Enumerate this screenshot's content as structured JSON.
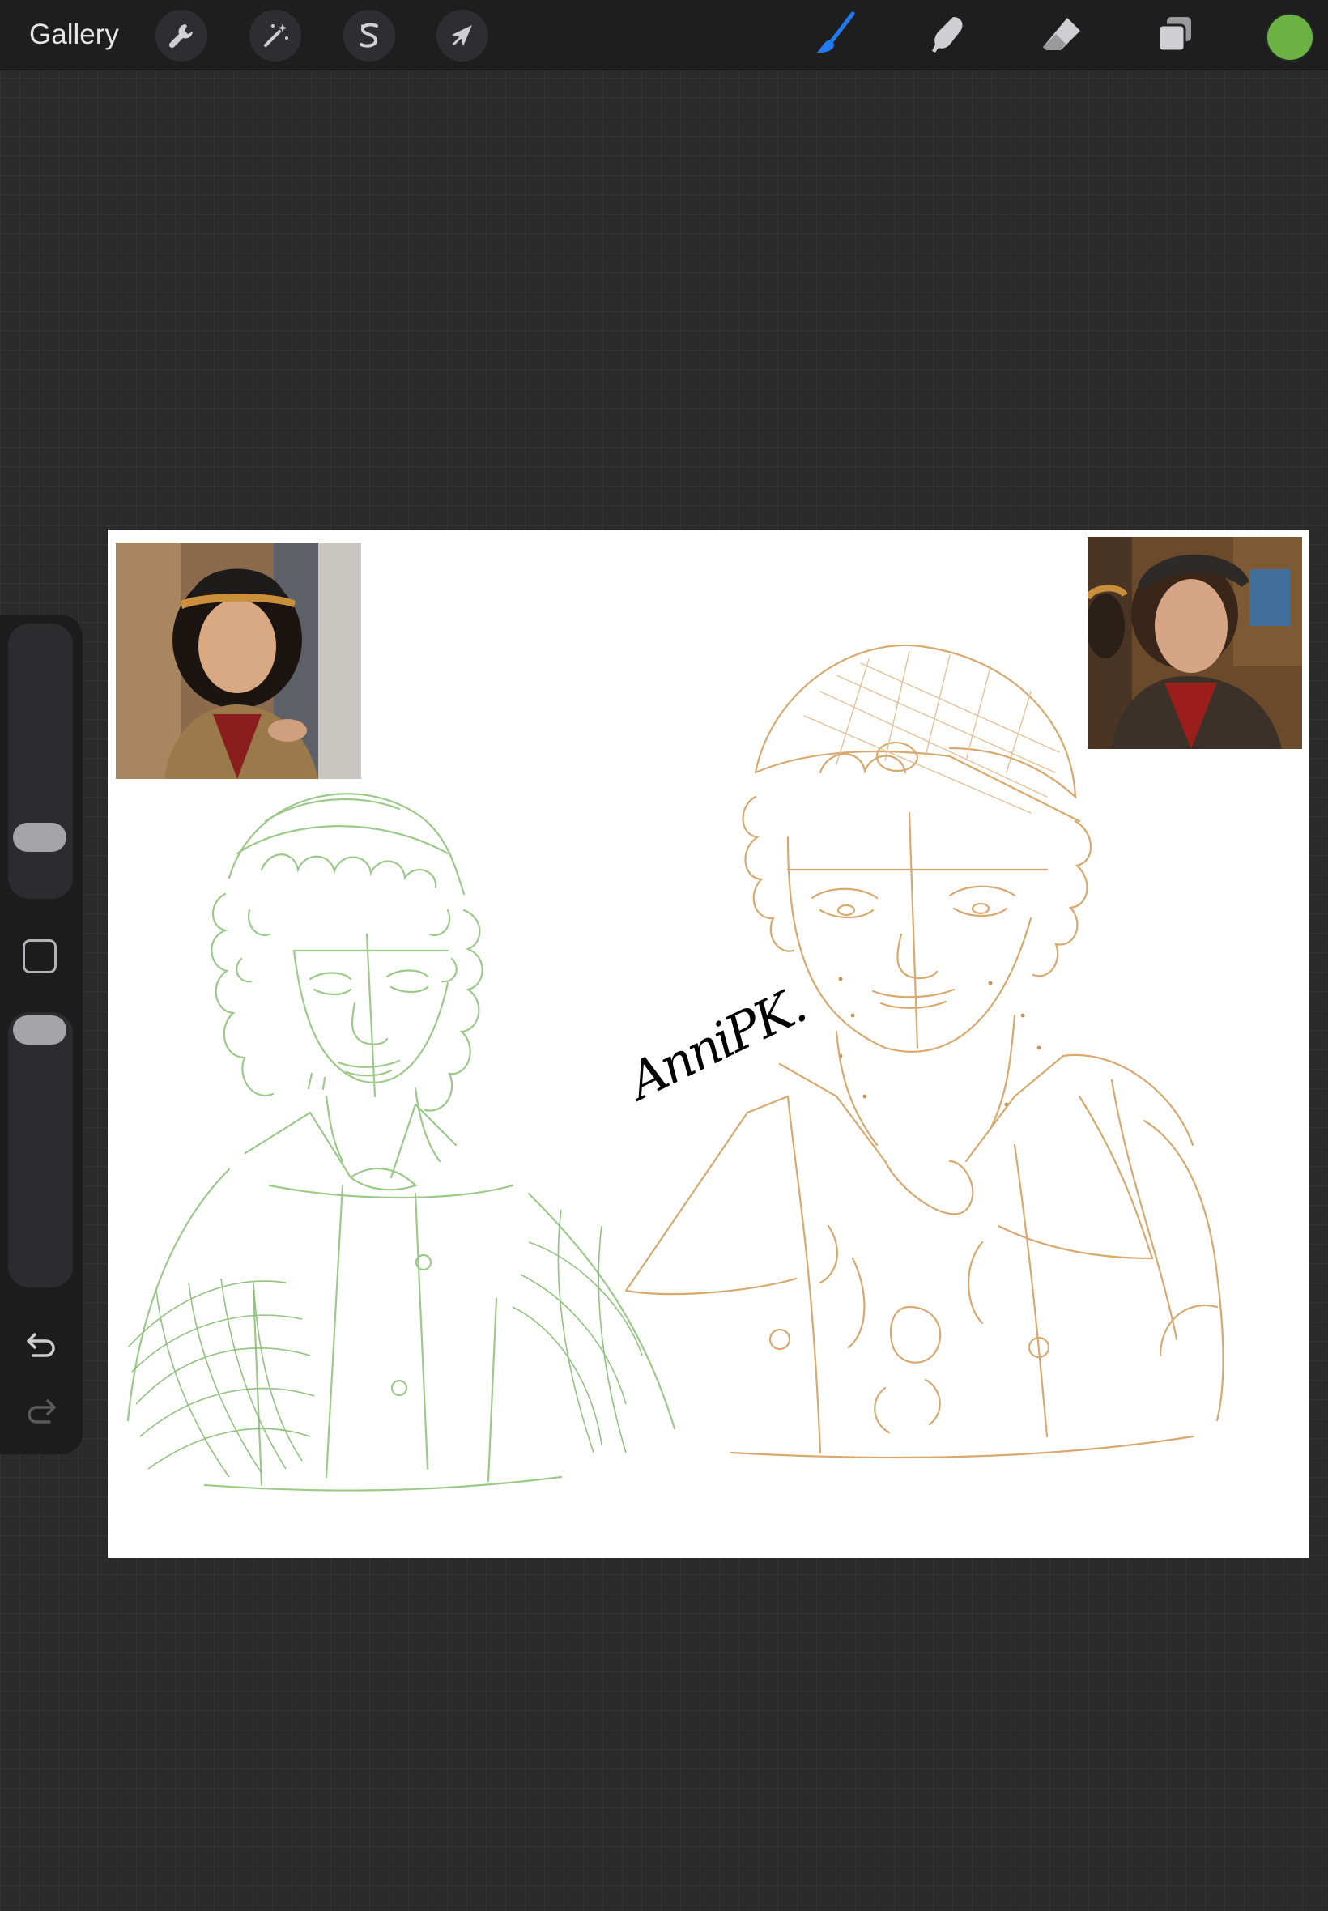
{
  "toolbar": {
    "gallery_label": "Gallery",
    "left_tools": [
      {
        "name": "actions",
        "icon": "wrench-icon"
      },
      {
        "name": "adjustments",
        "icon": "magic-wand-icon"
      },
      {
        "name": "selection",
        "icon": "selection-s-icon"
      },
      {
        "name": "transform",
        "icon": "arrow-cursor-icon"
      }
    ],
    "right_tools": [
      {
        "name": "brush",
        "icon": "brush-icon",
        "active": true
      },
      {
        "name": "smudge",
        "icon": "smudge-finger-icon"
      },
      {
        "name": "eraser",
        "icon": "eraser-icon"
      },
      {
        "name": "layers",
        "icon": "layers-icon"
      }
    ],
    "current_color": "#6ab342",
    "active_tool_color": "#1f7bf2"
  },
  "sidebar": {
    "brush_size_level": 0.3,
    "opacity_level": 0.2,
    "icons": [
      "modify-square-icon",
      "undo-icon",
      "redo-icon"
    ]
  },
  "canvas": {
    "signature": "AnniPK.",
    "sketch_colors": {
      "left_figure": "#9cc98a",
      "right_figure": "#d7a96e"
    }
  }
}
